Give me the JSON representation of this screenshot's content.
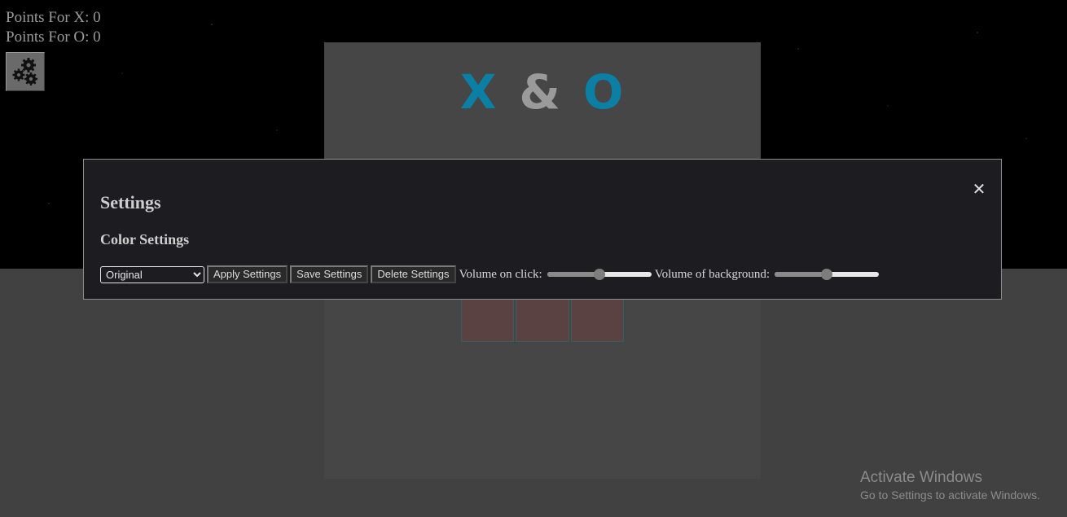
{
  "scores": {
    "x_label": "Points For X: 0",
    "o_label": "Points For O: 0"
  },
  "settings_button": {
    "icon": "gears-icon"
  },
  "game": {
    "title_x": "X",
    "title_amp": "&",
    "title_o": "O",
    "colors": {
      "accent": "#0b7fa4",
      "neutral": "#9a9a9a",
      "cell": "#5a4242",
      "panel": "#464646"
    }
  },
  "modal": {
    "title": "Settings",
    "close_icon": "close-icon",
    "close_glyph": "✕",
    "section_title": "Color Settings",
    "theme_select": {
      "selected": "Original",
      "options": [
        "Original"
      ]
    },
    "apply_label": "Apply Settings",
    "save_label": "Save Settings",
    "delete_label": "Delete Settings",
    "volume_click": {
      "label": "Volume on click:",
      "value": 0.5
    },
    "volume_background": {
      "label": "Volume of background:",
      "value": 0.5
    }
  },
  "watermark": {
    "title": "Activate Windows",
    "subtitle": "Go to Settings to activate Windows."
  }
}
